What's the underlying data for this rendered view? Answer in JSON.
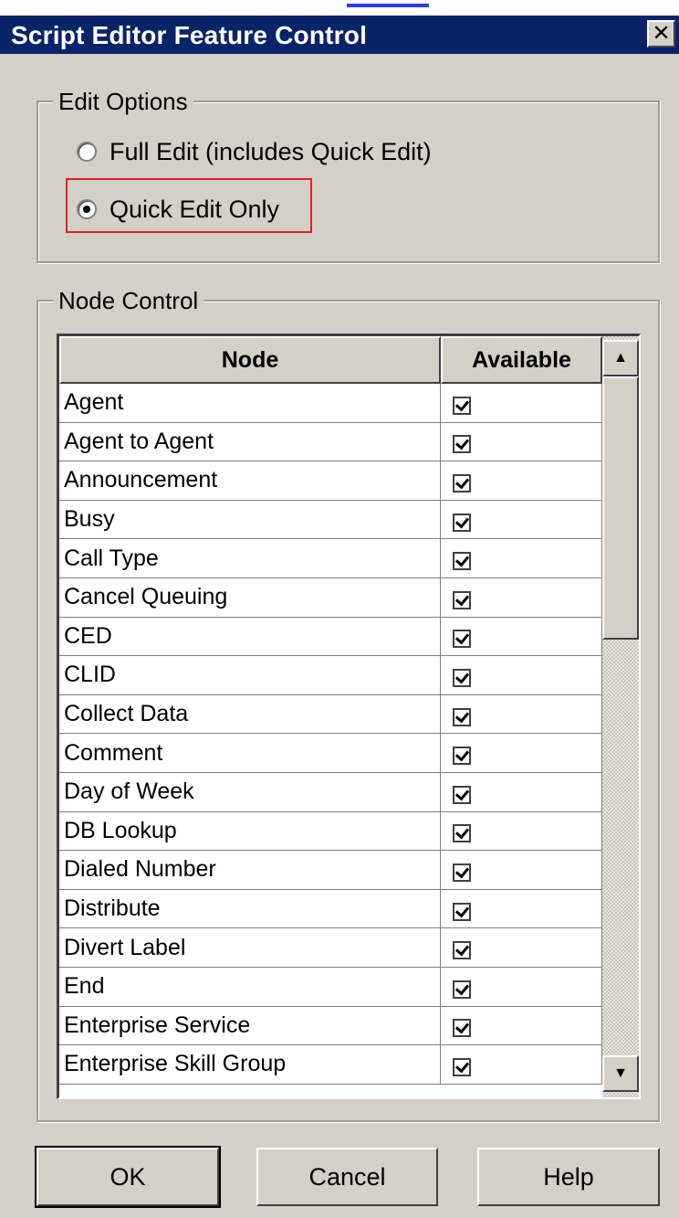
{
  "dialog": {
    "title": "Script Editor Feature Control",
    "close_glyph": "✕"
  },
  "edit_options": {
    "legend": "Edit Options",
    "options": [
      {
        "label": "Full Edit (includes Quick Edit)",
        "checked": false
      },
      {
        "label": "Quick Edit Only",
        "checked": true
      }
    ]
  },
  "node_control": {
    "legend": "Node Control",
    "columns": {
      "node": "Node",
      "available": "Available"
    },
    "rows": [
      {
        "node": "Agent",
        "available": true
      },
      {
        "node": "Agent to Agent",
        "available": true
      },
      {
        "node": "Announcement",
        "available": true
      },
      {
        "node": "Busy",
        "available": true
      },
      {
        "node": "Call Type",
        "available": true
      },
      {
        "node": "Cancel Queuing",
        "available": true
      },
      {
        "node": "CED",
        "available": true
      },
      {
        "node": "CLID",
        "available": true
      },
      {
        "node": "Collect Data",
        "available": true
      },
      {
        "node": "Comment",
        "available": true
      },
      {
        "node": "Day of Week",
        "available": true
      },
      {
        "node": "DB Lookup",
        "available": true
      },
      {
        "node": "Dialed Number",
        "available": true
      },
      {
        "node": "Distribute",
        "available": true
      },
      {
        "node": "Divert Label",
        "available": true
      },
      {
        "node": "End",
        "available": true
      },
      {
        "node": "Enterprise Service",
        "available": true
      },
      {
        "node": "Enterprise Skill Group",
        "available": true
      }
    ],
    "scrollbar": {
      "up_icon": "triangle-up",
      "down_icon": "triangle-down"
    }
  },
  "buttons": {
    "ok": "OK",
    "cancel": "Cancel",
    "help": "Help"
  }
}
